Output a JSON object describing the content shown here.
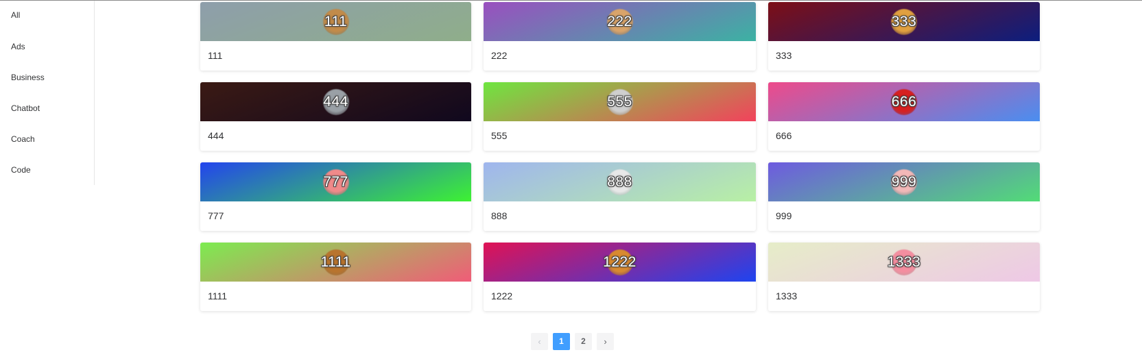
{
  "sidebar": {
    "items": [
      {
        "label": "All"
      },
      {
        "label": "Ads"
      },
      {
        "label": "Business"
      },
      {
        "label": "Chatbot"
      },
      {
        "label": "Coach"
      },
      {
        "label": "Code"
      }
    ]
  },
  "cards": [
    {
      "banner_text": "111",
      "title": "111",
      "gradient": [
        "#8e9eab",
        "#8fae8a"
      ],
      "emoji_color": "#c28b4a",
      "emoji_icon": "dog-face-icon"
    },
    {
      "banner_text": "222",
      "title": "222",
      "gradient": [
        "#9a4fbf",
        "#3cb2a3"
      ],
      "emoji_color": "#d9a46a",
      "emoji_icon": "dog-face-icon"
    },
    {
      "banner_text": "333",
      "title": "333",
      "gradient": [
        "#7d0f16",
        "#0c1e7e"
      ],
      "emoji_color": "#e0a040",
      "emoji_icon": "burger-icon"
    },
    {
      "banner_text": "444",
      "title": "444",
      "gradient": [
        "#3b1a14",
        "#10081e"
      ],
      "emoji_color": "#9aa0a6",
      "emoji_icon": "elephant-icon"
    },
    {
      "banner_text": "555",
      "title": "555",
      "gradient": [
        "#6ee640",
        "#f2425c"
      ],
      "emoji_color": "#cfcfcf",
      "emoji_icon": "pot-plant-icon"
    },
    {
      "banner_text": "666",
      "title": "666",
      "gradient": [
        "#ee4a8a",
        "#4a8ef0"
      ],
      "emoji_color": "#d62020",
      "emoji_icon": "crown-icon"
    },
    {
      "banner_text": "777",
      "title": "777",
      "gradient": [
        "#2344ee",
        "#3ef232"
      ],
      "emoji_color": "#f08a8a",
      "emoji_icon": "pig-face-icon"
    },
    {
      "banner_text": "888",
      "title": "888",
      "gradient": [
        "#9fb5ee",
        "#b8f0a4"
      ],
      "emoji_color": "#e8e8e8",
      "emoji_icon": "cow-face-icon"
    },
    {
      "banner_text": "999",
      "title": "999",
      "gradient": [
        "#6e5ae0",
        "#52dc76"
      ],
      "emoji_color": "#f2b8b8",
      "emoji_icon": "cow-face-icon"
    },
    {
      "banner_text": "1111",
      "title": "1111",
      "gradient": [
        "#7cec50",
        "#f05c78"
      ],
      "emoji_color": "#b8742e",
      "emoji_icon": "lion-face-icon"
    },
    {
      "banner_text": "1222",
      "title": "1222",
      "gradient": [
        "#e01254",
        "#1e44f0"
      ],
      "emoji_color": "#d88a30",
      "emoji_icon": "monkey-face-icon"
    },
    {
      "banner_text": "1333",
      "title": "1333",
      "gradient": [
        "#e6edc8",
        "#eec8e6"
      ],
      "emoji_color": "#f48ea0",
      "emoji_icon": "pig-face-icon"
    }
  ],
  "pagination": {
    "prev_icon": "‹",
    "next_icon": "›",
    "pages": [
      "1",
      "2"
    ],
    "current": "1"
  },
  "colors": {
    "accent": "#409eff",
    "pager_bg": "#f4f4f5"
  }
}
